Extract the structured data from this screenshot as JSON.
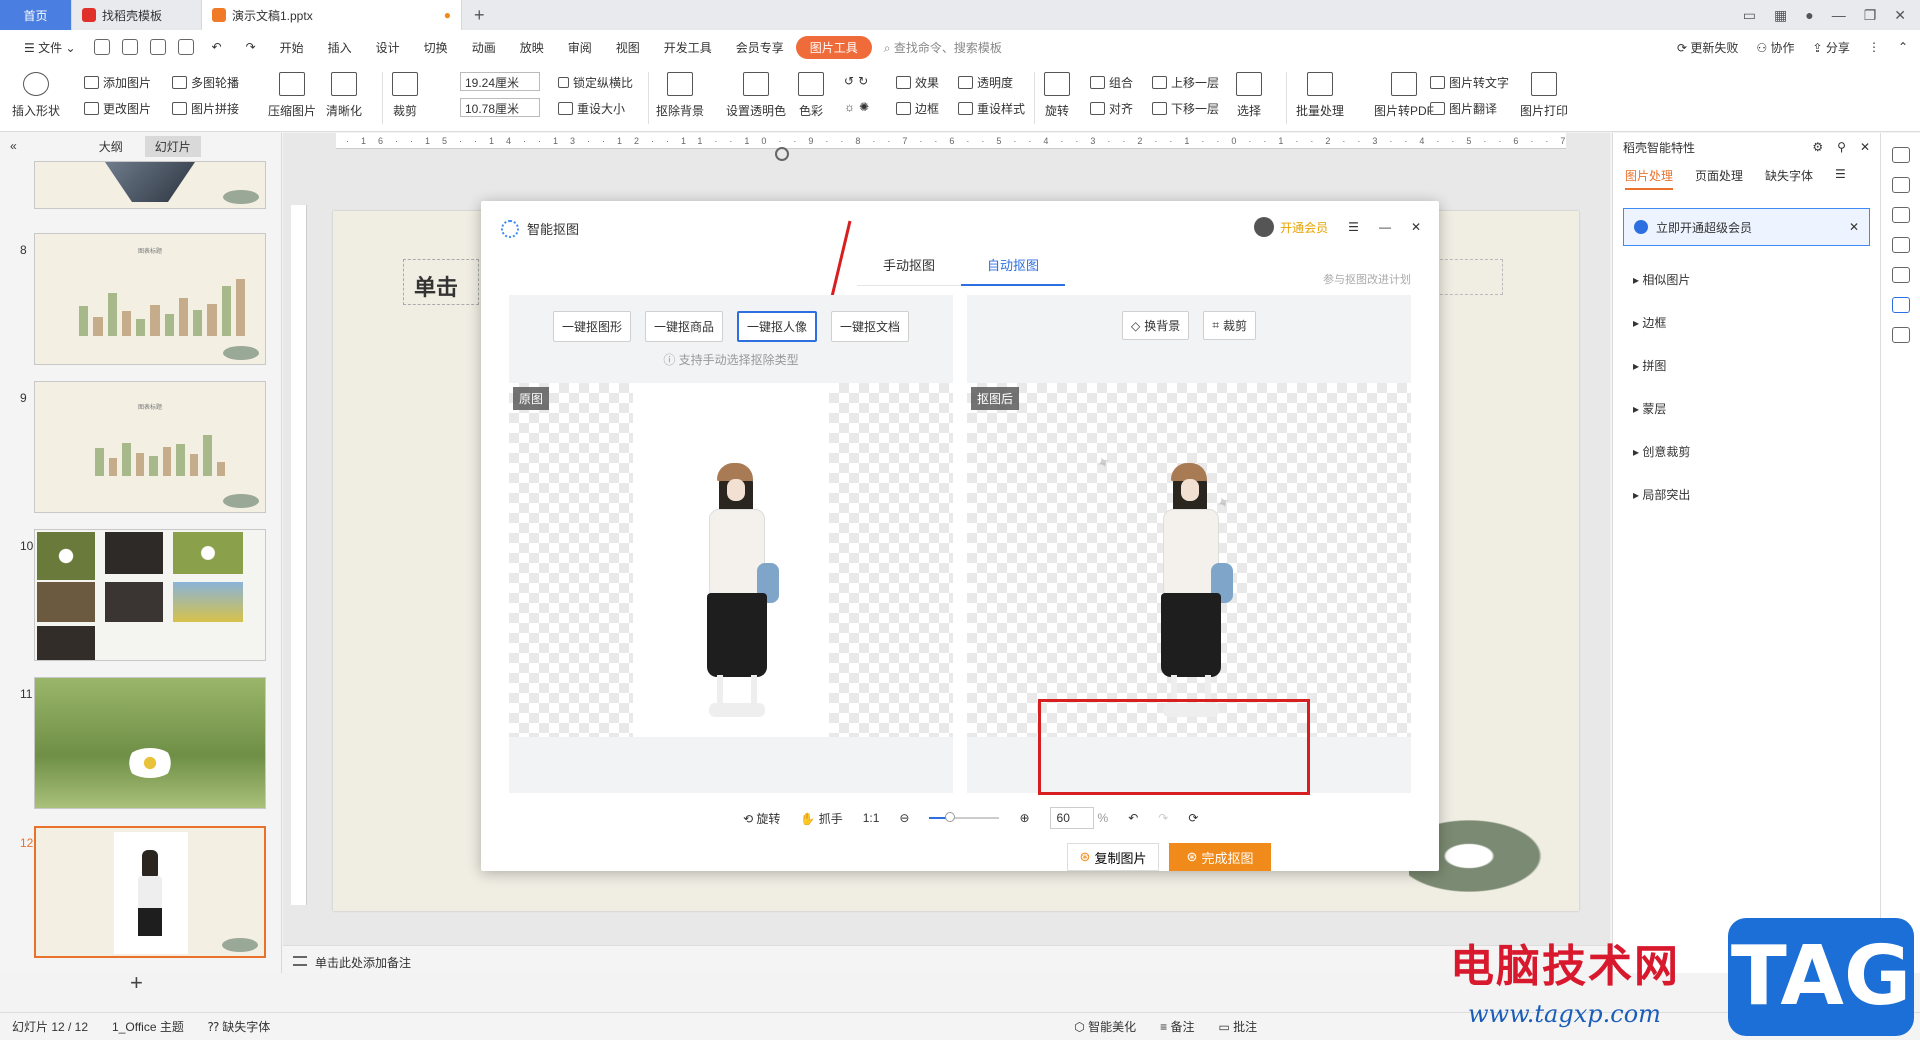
{
  "tabs": [
    {
      "label": "首页"
    },
    {
      "label": "找稻壳模板"
    },
    {
      "label": "演示文稿1.pptx"
    }
  ],
  "menu": {
    "file": "文件",
    "items": [
      "开始",
      "插入",
      "设计",
      "切换",
      "动画",
      "放映",
      "审阅",
      "视图",
      "开发工具",
      "会员专享"
    ],
    "active": "图片工具",
    "search": "查找命令、搜索模板",
    "right": [
      "更新失败",
      "协作",
      "分享"
    ]
  },
  "ribbon": {
    "insert_shape": "插入形状",
    "add_image": "添加图片",
    "change_image": "更改图片",
    "multi_outline": "多图轮播",
    "image_splice": "图片拼接",
    "compress": "压缩图片",
    "sharpen": "清晰化",
    "crop": "裁剪",
    "width": "19.24厘米",
    "height": "10.78厘米",
    "lock_ratio": "锁定纵横比",
    "reset_size": "重设大小",
    "remove_bg": "抠除背景",
    "set_transparent": "设置透明色",
    "color": "色彩",
    "effects": "效果",
    "border": "边框",
    "transparency": "透明度",
    "reset_style": "重设样式",
    "rotate": "旋转",
    "group": "组合",
    "align": "对齐",
    "up_layer": "上移一层",
    "down_layer": "下移一层",
    "select": "选择",
    "batch": "批量处理",
    "to_pdf": "图片转PDF",
    "to_text": "图片转文字",
    "translate": "图片翻译",
    "print": "图片打印"
  },
  "left_panel": {
    "tab_outline": "大纲",
    "tab_slides": "幻灯片",
    "slides": [
      {
        "num": "8",
        "title": "图表标题"
      },
      {
        "num": "9",
        "title": "图表标题"
      },
      {
        "num": "10",
        "title": ""
      },
      {
        "num": "11",
        "title": ""
      },
      {
        "num": "12",
        "title": ""
      }
    ]
  },
  "canvas": {
    "slide_title": "单击",
    "notes": "单击此处添加备注",
    "ruler_marks": "·16··15··14··13··12··11··10··9··8··7··6··5··4··3··2··1··0··1··2··3··4··5··6··7··8··9··10··11··12··13··14··15··16·"
  },
  "dialog": {
    "title": "智能抠图",
    "vip": "开通会员",
    "tab_manual": "手动抠图",
    "tab_auto": "自动抠图",
    "join_plan": "参与抠图改进计划",
    "options": [
      "一键抠图形",
      "一键抠商品",
      "一键抠人像",
      "一键抠文档"
    ],
    "hint": "支持手动选择抠除类型",
    "right_actions": [
      "换背景",
      "裁剪"
    ],
    "label_original": "原图",
    "label_result": "抠图后",
    "copy_image": "复制图片",
    "finish": "完成抠图",
    "rotate": "旋转",
    "grab": "抓手",
    "zoom_value": "60",
    "zoom_unit": "%",
    "zoom_level": 0.3
  },
  "right_panel": {
    "header": "稻壳智能特性",
    "tabs": [
      "图片处理",
      "页面处理",
      "缺失字体"
    ],
    "banner": "立即开通超级会员",
    "items": [
      "相似图片",
      "边框",
      "拼图",
      "蒙层",
      "创意裁剪",
      "局部突出"
    ]
  },
  "status": {
    "slide_info": "幻灯片 12 / 12",
    "theme": "1_Office 主题",
    "missing_font": "缺失字体",
    "beautify": "智能美化",
    "notes": "备注",
    "comment": "批注"
  },
  "watermark": {
    "brand": "电脑技术网",
    "url": "www.tagxp.com",
    "tag": "TAG"
  },
  "colors": {
    "accent_orange": "#f08a1a",
    "accent_blue": "#2d6fe0",
    "annotation_red": "#d81f1f"
  }
}
